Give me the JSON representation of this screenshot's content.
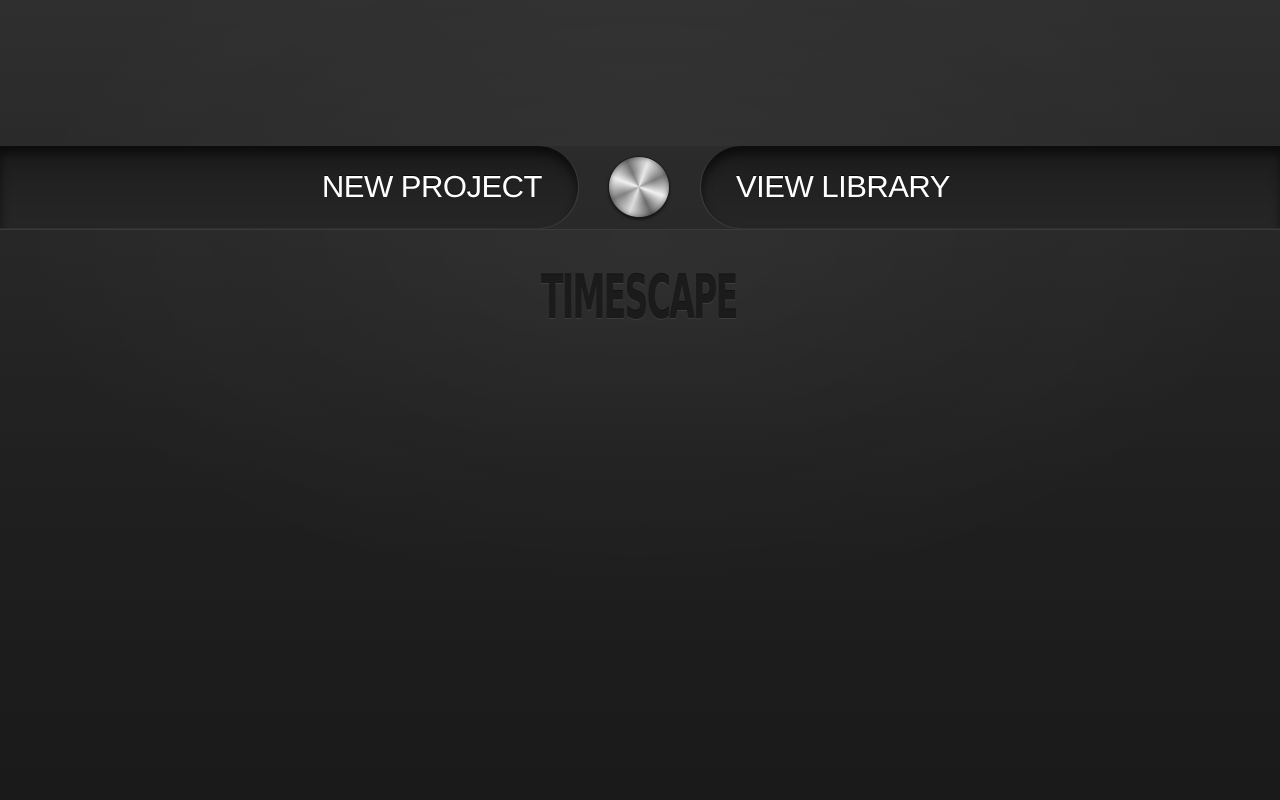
{
  "app": {
    "logo_text": "TIMESCAPE"
  },
  "menu": {
    "new_project_label": "NEW PROJECT",
    "view_library_label": "VIEW LIBRARY",
    "center_knob_icon": "metal-knob-icon"
  },
  "colors": {
    "background": "#252525",
    "label": "#ffffff",
    "logo": "#1b1b1b"
  }
}
